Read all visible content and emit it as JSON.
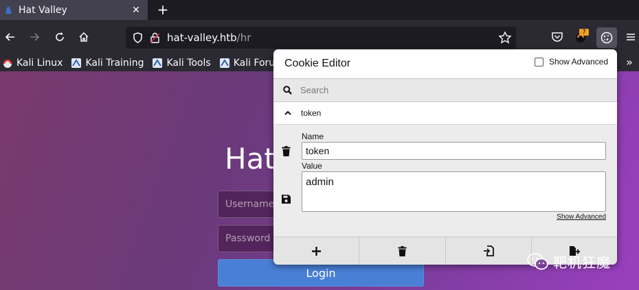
{
  "browser": {
    "tab_title": "Hat Valley",
    "tab_close": "✕",
    "new_tab": "+",
    "url_host": "hat-valley.htb",
    "url_path": "/hr",
    "extension_badge": "7"
  },
  "bookmarks": [
    {
      "label": "Kali Linux"
    },
    {
      "label": "Kali Training"
    },
    {
      "label": "Kali Tools"
    },
    {
      "label": "Kali Forums"
    }
  ],
  "bookmarks_overflow": "»",
  "page": {
    "title": "Hat",
    "username_placeholder": "Username",
    "password_placeholder": "Password",
    "login_label": "Login"
  },
  "cookie_editor": {
    "title": "Cookie Editor",
    "show_advanced_label": "Show Advanced",
    "search_placeholder": "Search",
    "cookie_name": "token",
    "name_label": "Name",
    "name_value": "token",
    "value_label": "Value",
    "value_value": "admin",
    "show_advanced_link": "Show Advanced"
  },
  "watermark": {
    "text": "靶机狂魔"
  },
  "colors": {
    "accent_button": "#4a7fd6",
    "badge": "#f0a020"
  }
}
